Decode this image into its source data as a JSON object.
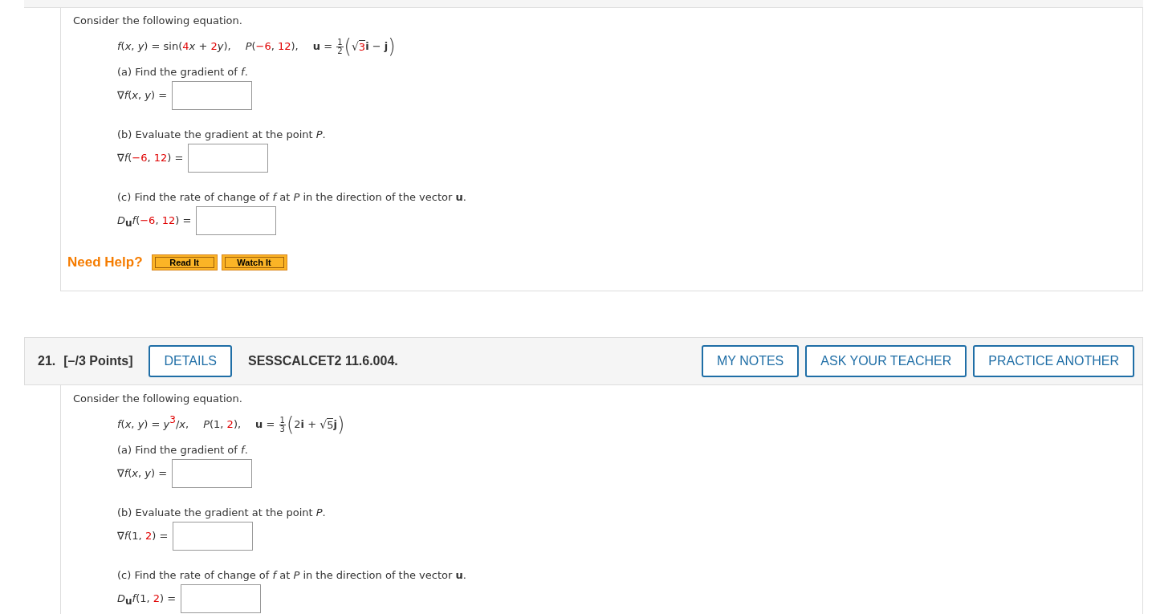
{
  "problems": [
    {
      "intro": "Consider the following equation.",
      "equation": [
        [
          {
            "kind": "i",
            "text": "f"
          },
          {
            "kind": "t",
            "text": "("
          },
          {
            "kind": "i",
            "text": "x"
          },
          {
            "kind": "t",
            "text": ", "
          },
          {
            "kind": "i",
            "text": "y"
          },
          {
            "kind": "t",
            "text": ") = sin("
          },
          {
            "kind": "r",
            "text": "4"
          },
          {
            "kind": "i",
            "text": "x"
          },
          {
            "kind": "t",
            "text": " + "
          },
          {
            "kind": "r",
            "text": "2"
          },
          {
            "kind": "i",
            "text": "y"
          },
          {
            "kind": "t",
            "text": "),"
          }
        ],
        [
          {
            "kind": "i",
            "text": "P"
          },
          {
            "kind": "t",
            "text": "("
          },
          {
            "kind": "r",
            "text": "−6"
          },
          {
            "kind": "t",
            "text": ", "
          },
          {
            "kind": "r",
            "text": "12"
          },
          {
            "kind": "t",
            "text": "),"
          }
        ],
        [
          {
            "kind": "b",
            "text": "u"
          },
          {
            "kind": "t",
            "text": " = "
          },
          {
            "kind": "frac",
            "num": "1",
            "den": "2"
          },
          {
            "kind": "paren",
            "open": "(",
            "close": ")",
            "parts": [
              {
                "kind": "sqrt",
                "radical": "√",
                "parts": [
                  {
                    "kind": "r",
                    "text": "3"
                  }
                ]
              },
              {
                "kind": "b",
                "text": "i"
              },
              {
                "kind": "t",
                "text": " − "
              },
              {
                "kind": "b",
                "text": "j"
              }
            ]
          }
        ]
      ],
      "parts": [
        {
          "prompt": "(a) Find the gradient of *f*.",
          "lhs": [
            {
              "kind": "t",
              "text": "∇"
            },
            {
              "kind": "i",
              "text": "f"
            },
            {
              "kind": "t",
              "text": "("
            },
            {
              "kind": "i",
              "text": "x"
            },
            {
              "kind": "t",
              "text": ", "
            },
            {
              "kind": "i",
              "text": "y"
            },
            {
              "kind": "t",
              "text": ") ="
            }
          ]
        },
        {
          "prompt": "(b) Evaluate the gradient at the point *P*.",
          "lhs": [
            {
              "kind": "t",
              "text": "∇"
            },
            {
              "kind": "i",
              "text": "f"
            },
            {
              "kind": "t",
              "text": "("
            },
            {
              "kind": "r",
              "text": "−6"
            },
            {
              "kind": "t",
              "text": ", "
            },
            {
              "kind": "r",
              "text": "12"
            },
            {
              "kind": "t",
              "text": ") ="
            }
          ]
        },
        {
          "prompt": "(c) Find the rate of change of *f* at *P* in the direction of the vector **u**.",
          "lhs": [
            {
              "kind": "i",
              "text": "D"
            },
            {
              "kind": "bs",
              "text": "u"
            },
            {
              "kind": "i",
              "text": "f"
            },
            {
              "kind": "t",
              "text": "("
            },
            {
              "kind": "r",
              "text": "−6"
            },
            {
              "kind": "t",
              "text": ", "
            },
            {
              "kind": "r",
              "text": "12"
            },
            {
              "kind": "t",
              "text": ") ="
            }
          ]
        }
      ],
      "need_help": {
        "label": "Need Help?",
        "buttons": [
          "Read It",
          "Watch It"
        ]
      }
    },
    {
      "header": {
        "number": "21.",
        "points": "[–/3 Points]",
        "details": "DETAILS",
        "code": "SESSCALCET2 11.6.004.",
        "actions": [
          "MY NOTES",
          "ASK YOUR TEACHER",
          "PRACTICE ANOTHER"
        ]
      },
      "intro": "Consider the following equation.",
      "equation": [
        [
          {
            "kind": "i",
            "text": "f"
          },
          {
            "kind": "t",
            "text": "("
          },
          {
            "kind": "i",
            "text": "x"
          },
          {
            "kind": "t",
            "text": ", "
          },
          {
            "kind": "i",
            "text": "y"
          },
          {
            "kind": "t",
            "text": ") = "
          },
          {
            "kind": "i",
            "text": "y"
          },
          {
            "kind": "rs",
            "text": "3"
          },
          {
            "kind": "t",
            "text": "/"
          },
          {
            "kind": "i",
            "text": "x"
          },
          {
            "kind": "t",
            "text": ","
          }
        ],
        [
          {
            "kind": "i",
            "text": "P"
          },
          {
            "kind": "t",
            "text": "(1, "
          },
          {
            "kind": "r",
            "text": "2"
          },
          {
            "kind": "t",
            "text": "),"
          }
        ],
        [
          {
            "kind": "b",
            "text": "u"
          },
          {
            "kind": "t",
            "text": " = "
          },
          {
            "kind": "frac",
            "num": "1",
            "den": "3"
          },
          {
            "kind": "paren",
            "open": "(",
            "close": ")",
            "parts": [
              {
                "kind": "t",
                "text": "2"
              },
              {
                "kind": "b",
                "text": "i"
              },
              {
                "kind": "t",
                "text": " + "
              },
              {
                "kind": "sqrt",
                "radical": "√",
                "parts": [
                  {
                    "kind": "t",
                    "text": "5"
                  }
                ]
              },
              {
                "kind": "b",
                "text": "j"
              }
            ]
          }
        ]
      ],
      "parts": [
        {
          "prompt": "(a) Find the gradient of *f*.",
          "lhs": [
            {
              "kind": "t",
              "text": "∇"
            },
            {
              "kind": "i",
              "text": "f"
            },
            {
              "kind": "t",
              "text": "("
            },
            {
              "kind": "i",
              "text": "x"
            },
            {
              "kind": "t",
              "text": ", "
            },
            {
              "kind": "i",
              "text": "y"
            },
            {
              "kind": "t",
              "text": ") ="
            }
          ]
        },
        {
          "prompt": "(b) Evaluate the gradient at the point *P*.",
          "lhs": [
            {
              "kind": "t",
              "text": "∇"
            },
            {
              "kind": "i",
              "text": "f"
            },
            {
              "kind": "t",
              "text": "(1, "
            },
            {
              "kind": "r",
              "text": "2"
            },
            {
              "kind": "t",
              "text": ") ="
            }
          ]
        },
        {
          "prompt": "(c) Find the rate of change of *f* at *P* in the direction of the vector **u**.",
          "lhs": [
            {
              "kind": "i",
              "text": "D"
            },
            {
              "kind": "bs",
              "text": "u"
            },
            {
              "kind": "i",
              "text": "f"
            },
            {
              "kind": "t",
              "text": "(1, "
            },
            {
              "kind": "r",
              "text": "2"
            },
            {
              "kind": "t",
              "text": ") ="
            }
          ]
        }
      ]
    }
  ]
}
